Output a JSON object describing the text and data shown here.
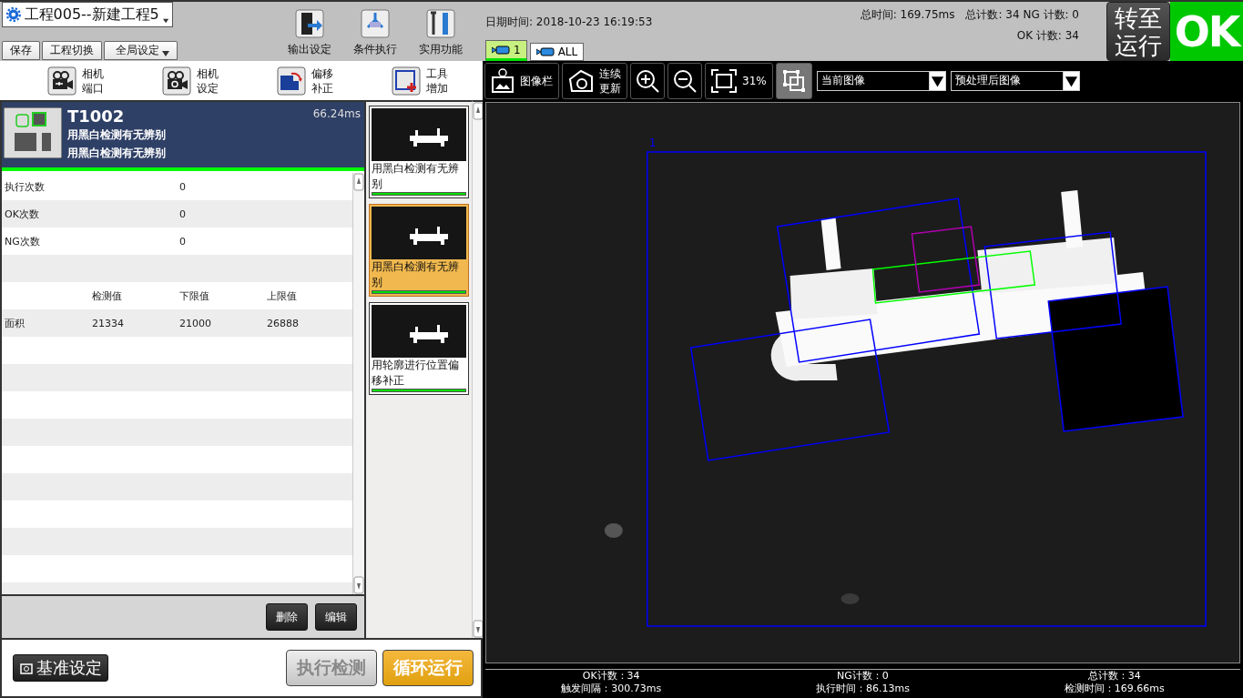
{
  "project": {
    "title": "工程005--新建工程5"
  },
  "file_buttons": [
    {
      "label": "保存",
      "kind": "plain"
    },
    {
      "label": "工程切换",
      "kind": "plain"
    },
    {
      "label": "全局设定",
      "kind": "dropdown"
    }
  ],
  "main_tools": [
    {
      "label": "输出设定",
      "kind": "output"
    },
    {
      "label": "条件执行",
      "kind": "branch"
    },
    {
      "label": "实用功能",
      "kind": "tools"
    }
  ],
  "datetime": "日期时间: 2018-10-23 16:19:53",
  "cameras": [
    {
      "label": "1",
      "selected": true
    },
    {
      "label": "ALL",
      "selected": false
    }
  ],
  "stats": {
    "line_1": [
      "总时间:  169.75ms",
      "总计数: 34 NG 计数: 0"
    ],
    "line_2": "OK 计数: 34"
  },
  "run_button": {
    "lines": [
      "转至",
      "运行"
    ]
  },
  "result": {
    "label": "OK",
    "color": "#00c800"
  },
  "tool_buttons": [
    {
      "kind": "camera-port",
      "lines": [
        "相机",
        "端口"
      ]
    },
    {
      "kind": "camera-settings",
      "lines": [
        "相机",
        "设定"
      ]
    },
    {
      "kind": "offset",
      "lines": [
        "偏移",
        "补正"
      ]
    },
    {
      "kind": "add-tool",
      "lines": [
        "工具",
        "增加"
      ]
    }
  ],
  "view_toolbar": {
    "image_bar": "图像栏",
    "continuous": [
      "连续",
      "更新"
    ],
    "zoom": "31%",
    "dropdowns": [
      {
        "value": "当前图像"
      },
      {
        "value": "预处理后图像"
      }
    ]
  },
  "tool_header": {
    "id": "T1002",
    "time": "66.24ms",
    "lines": [
      "用黑白检测有无辨别",
      "用黑白检测有无辨别"
    ],
    "color": "#00ff00"
  },
  "counts": [
    {
      "label": "执行次数",
      "value": "0"
    },
    {
      "label": "OK次数",
      "value": "0"
    },
    {
      "label": "NG次数",
      "value": "0"
    }
  ],
  "measure": {
    "columns": [
      "检测值",
      "下限值",
      "上限值"
    ],
    "rows": [
      {
        "label": "面积",
        "values": [
          "21334",
          "21000",
          "26888"
        ]
      }
    ]
  },
  "edit_buttons": [
    "删除",
    "编辑"
  ],
  "tool_list": [
    {
      "label": "用黑白检测有无辨别",
      "selected": false,
      "color": "#00e000"
    },
    {
      "label": "用黑白检测有无辨别",
      "selected": true,
      "color": "#00e000"
    },
    {
      "label": "用轮廓进行位置偏移补正",
      "selected": false,
      "color": "#00e000"
    }
  ],
  "bottom": {
    "baseline": "基准设定",
    "execute": {
      "label": "执行检测",
      "disabled": true
    },
    "loop": "循环运行"
  },
  "roi_label": "1",
  "status_bar": [
    {
      "lines": [
        "OK计数：34",
        "触发间隔：300.73ms"
      ]
    },
    {
      "lines": [
        "NG计数：0",
        "执行时间：86.13ms"
      ]
    },
    {
      "lines": [
        "总计数：34",
        "检测时间：169.66ms"
      ]
    }
  ]
}
